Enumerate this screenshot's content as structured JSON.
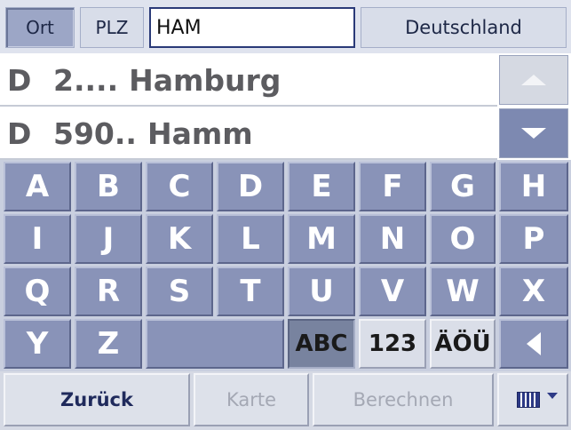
{
  "top": {
    "tab_ort": "Ort",
    "tab_plz": "PLZ",
    "search_value": "HAM",
    "country": "Deutschland"
  },
  "results": [
    {
      "country": "D",
      "plz": "2....",
      "city": "Hamburg"
    },
    {
      "country": "D",
      "plz": "590..",
      "city": "Hamm"
    }
  ],
  "keys": {
    "row1": [
      "A",
      "B",
      "C",
      "D",
      "E",
      "F",
      "G",
      "H"
    ],
    "row2": [
      "I",
      "J",
      "K",
      "L",
      "M",
      "N",
      "O",
      "P"
    ],
    "row3": [
      "Q",
      "R",
      "S",
      "T",
      "U",
      "V",
      "W",
      "X"
    ],
    "row4": [
      "Y",
      "Z"
    ],
    "mode_abc": "ABC",
    "mode_123": "123",
    "mode_umlaut": "ÄÖÜ"
  },
  "icons": {
    "scroll_up": "triangle-up-icon",
    "scroll_down": "triangle-down-icon",
    "backspace": "triangle-left-icon",
    "keyboard": "keyboard-icon"
  },
  "bottom": {
    "back": "Zurück",
    "map": "Karte",
    "calculate": "Berechnen"
  },
  "colors": {
    "key_blue": "#8993b8",
    "disabled_text": "#a4a8b4",
    "active_mode": "#78839f"
  }
}
